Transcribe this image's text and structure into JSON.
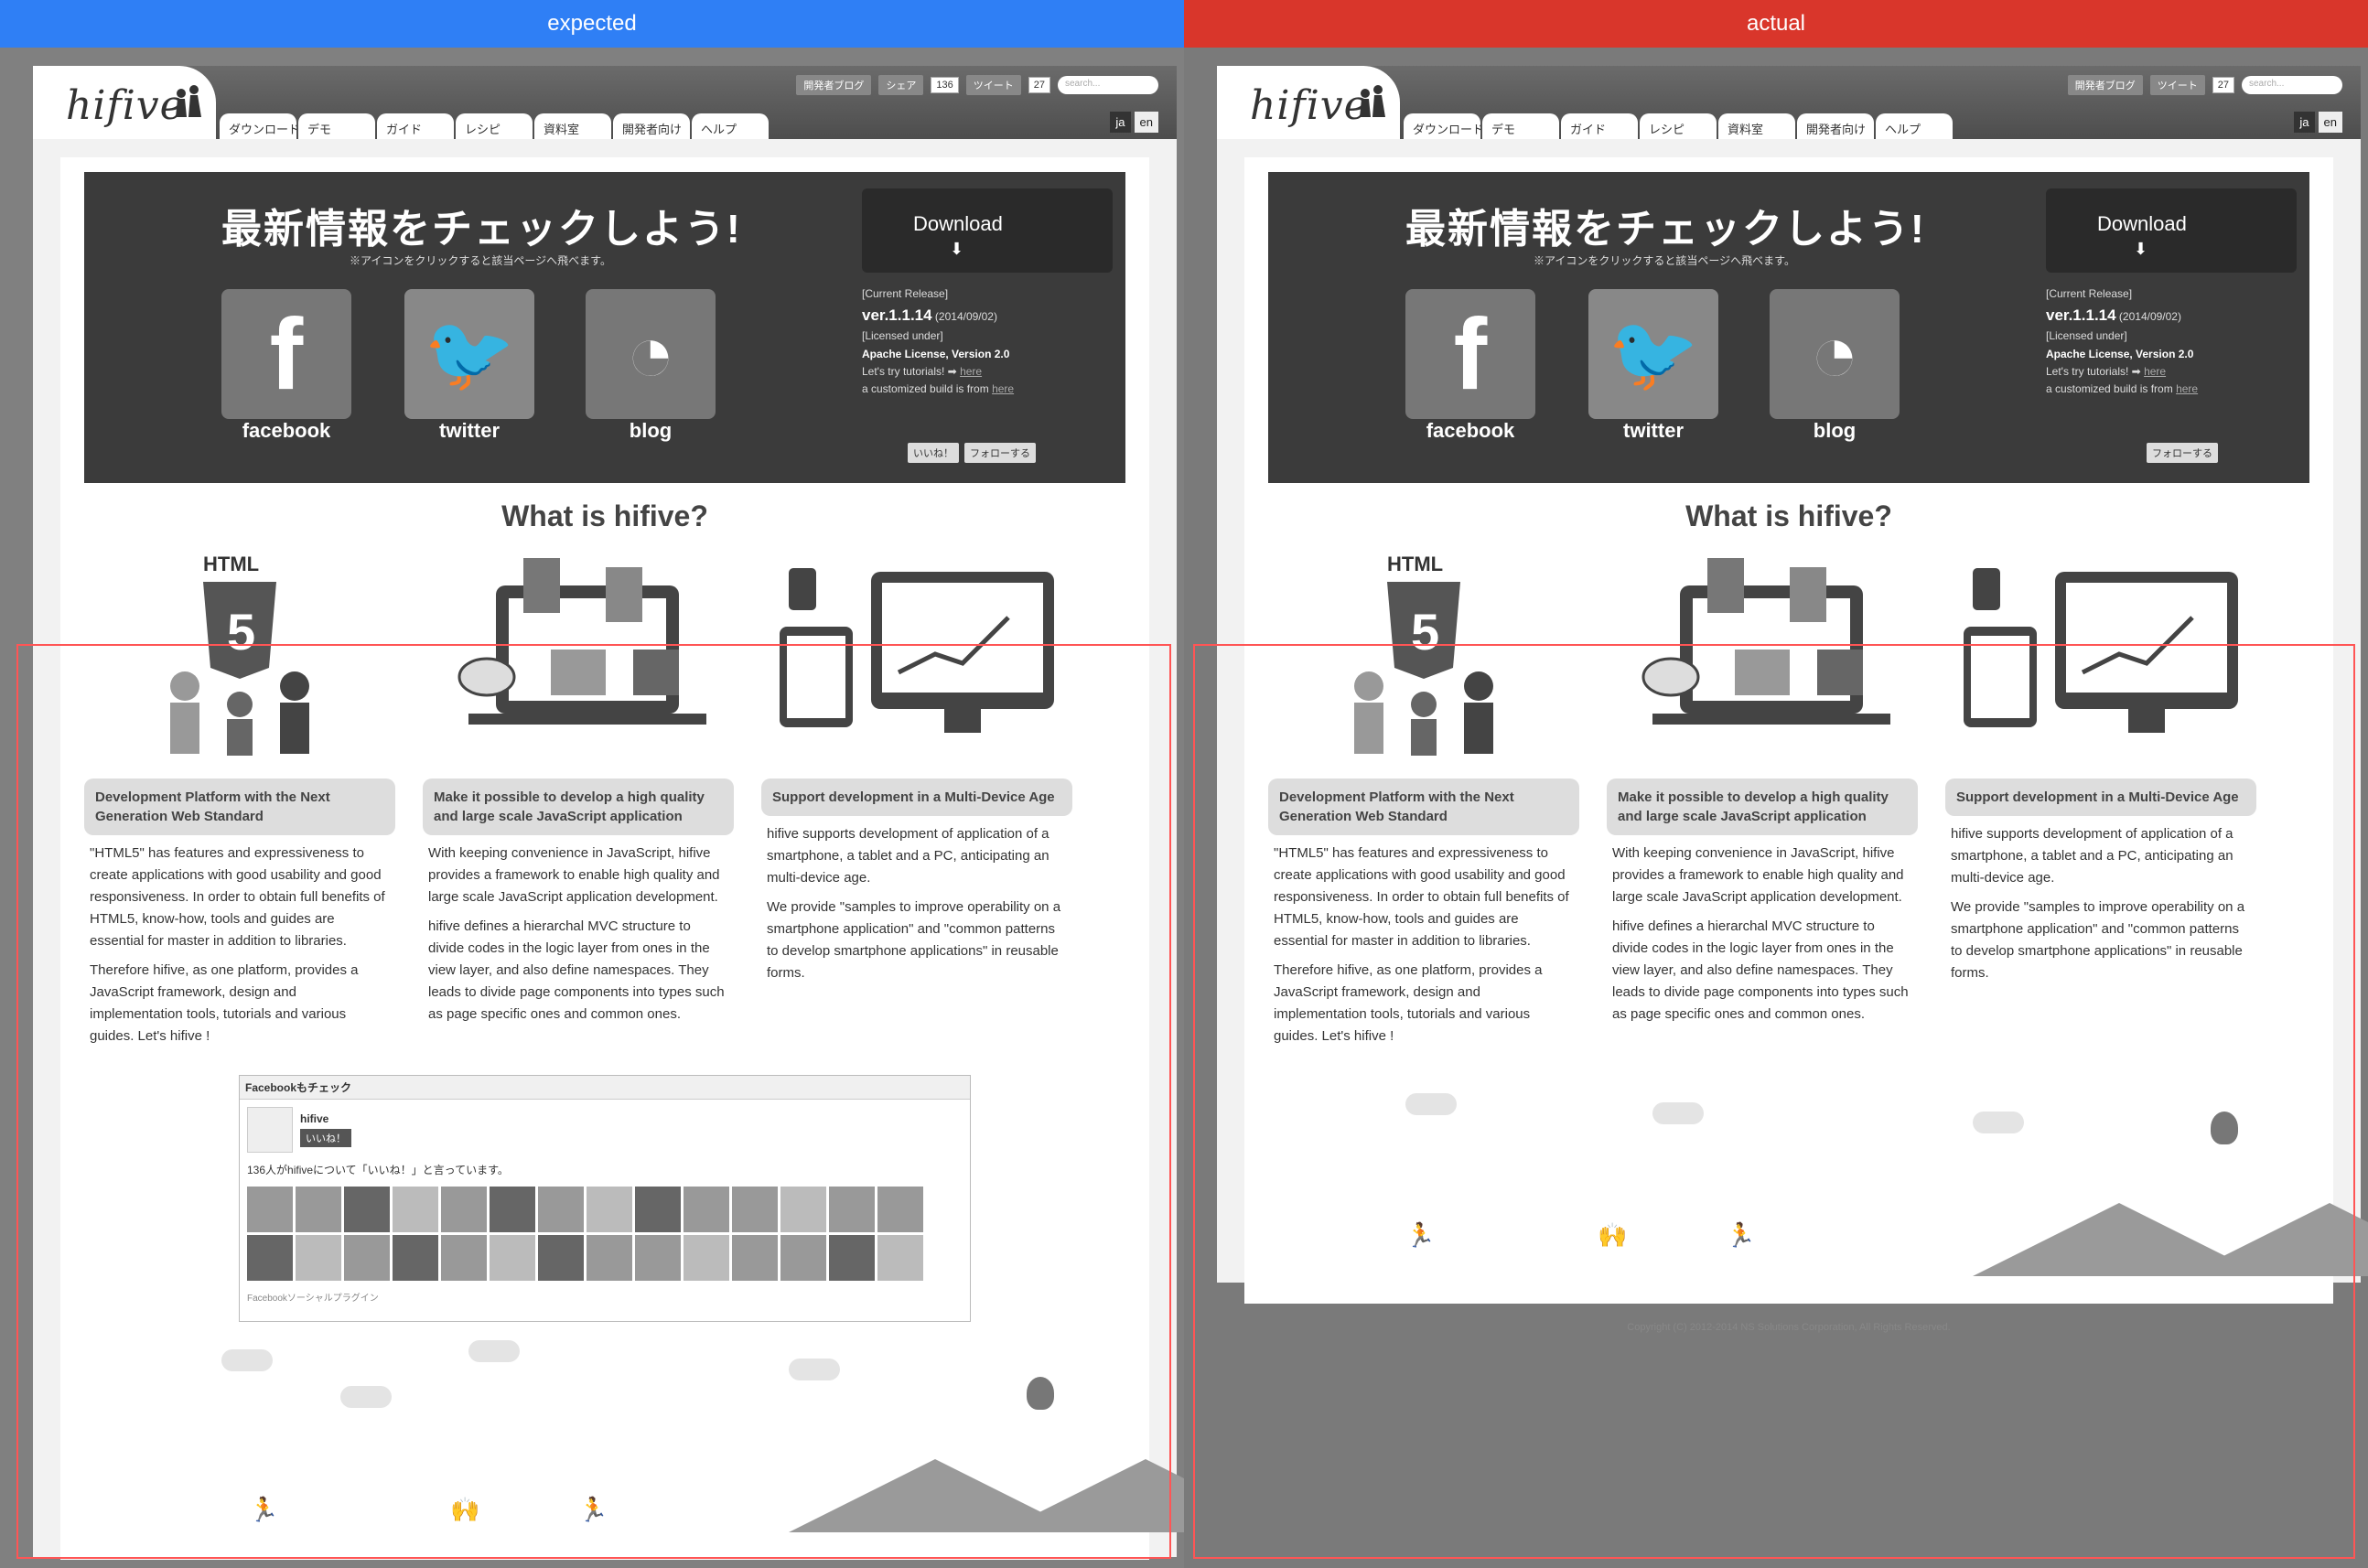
{
  "labels": {
    "left": "expected",
    "right": "actual"
  },
  "nav": {
    "tabs": [
      "ダウンロード",
      "デモ",
      "ガイド",
      "レシピ",
      "資料室",
      "開発者向け",
      "ヘルプ"
    ],
    "dev_blog": "開発者ブログ",
    "share": "シェア",
    "share_count": "136",
    "tweet": "ツイート",
    "tweet_count": "27",
    "search_placeholder": "search...",
    "lang_ja": "ja",
    "lang_en": "en"
  },
  "logo": {
    "text": "hifive"
  },
  "hero": {
    "title": "最新情報をチェックしよう!",
    "subtitle": "※アイコンをクリックすると該当ページへ飛べます。",
    "sns": [
      "facebook",
      "twitter",
      "blog"
    ],
    "download": "Download",
    "current_release_label": "[Current Release]",
    "version": "ver.1.1.14",
    "date": "(2014/09/02)",
    "licensed_label": "[Licensed under]",
    "license": "Apache License, Version 2.0",
    "try_tutorials": "Let's try tutorials! ➡",
    "try_link": "here",
    "customized": "a customized build is from",
    "customized_link": "here",
    "like_btn": "いいね！",
    "follow_btn": "フォローする"
  },
  "whatis": "What is hifive?",
  "columns": [
    {
      "title": "Development Platform with the Next Generation Web Standard",
      "text1": "\"HTML5\" has features and expressiveness to create applications with good usability and good responsiveness. In order to obtain full benefits of HTML5, know-how, tools and guides are essential for master in addition to libraries.",
      "text2": "Therefore hifive, as one platform, provides a JavaScript framework, design and implementation tools, tutorials and various guides. Let's hifive !"
    },
    {
      "title": "Make it possible to develop a high quality and large scale JavaScript application",
      "text1": "With keeping convenience in JavaScript, hifive provides a framework to enable high quality and large scale JavaScript application development.",
      "text2": "hifive defines a hierarchal MVC structure to divide codes in the logic layer from ones in the view layer, and also define namespaces. They leads to divide page components into types such as page specific ones and common ones."
    },
    {
      "title": "Support development in a Multi-Device Age",
      "text1": "hifive supports development of application of a smartphone, a tablet and a PC, anticipating an multi-device age.",
      "text2": "We provide \"samples to improve operability on a smartphone application\" and \"common patterns to develop smartphone applications\" in reusable forms."
    }
  ],
  "fbwidget": {
    "header": "Facebookもチェック",
    "page_name": "hifive",
    "like": "いいね！",
    "count_text": "136人がhifiveについて「いいね！」と言っています。",
    "footer": "Facebookソーシャルプラグイン"
  },
  "footer": "Copyright (C) 2012-2014 NS Solutions Corporation, All Rights Reserved."
}
